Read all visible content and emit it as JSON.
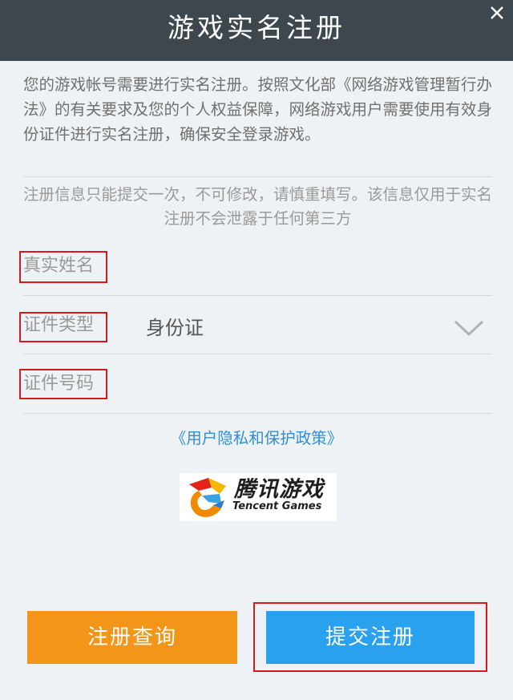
{
  "header": {
    "title": "游戏实名注册"
  },
  "intro": {
    "text": "您的游戏帐号需要进行实名注册。按照文化部《网络游戏管理暂行办法》的有关要求及您的个人权益保障，网络游戏用户需要使用有效身份证件进行实名注册，确保安全登录游戏。"
  },
  "notice": {
    "text": "注册信息只能提交一次，不可修改，请慎重填写。该信息仅用于实名注册不会泄露于任何第三方"
  },
  "form": {
    "real_name_label": "真实姓名",
    "real_name_value": "",
    "id_type_label": "证件类型",
    "id_type_value": "身份证",
    "id_number_label": "证件号码",
    "id_number_value": ""
  },
  "policy_link": "《用户隐私和保护政策》",
  "logo": {
    "cn": "腾讯游戏",
    "en": "Tencent Games"
  },
  "buttons": {
    "query": "注册查询",
    "submit": "提交注册"
  },
  "colors": {
    "header_bg": "#3f474e",
    "query_button": "#f39519",
    "submit_button": "#2aa1ee",
    "link": "#2f8fd6",
    "highlight_box": "#d7191d"
  }
}
